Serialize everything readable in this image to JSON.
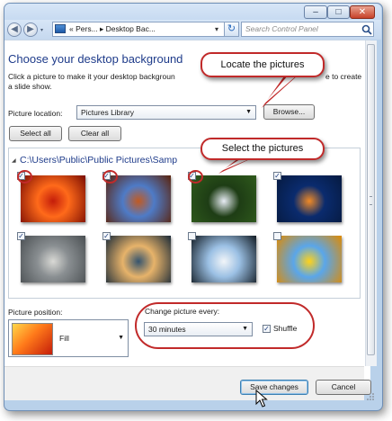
{
  "window": {
    "minimize_glyph": "–",
    "maximize_glyph": "□",
    "close_glyph": "✕"
  },
  "nav": {
    "back_glyph": "◀",
    "forward_glyph": "▶",
    "breadcrumb": "«  Pers...  ▸  Desktop Bac...",
    "dropdown_glyph": "▾",
    "refresh_glyph": "↻",
    "search_placeholder": "Search Control Panel",
    "search_icon": "search-icon"
  },
  "page": {
    "title": "Choose your desktop background",
    "desc_left": "Click a picture to make it your desktop backgroun",
    "desc_right": "e to create",
    "desc_line2": "a slide show.",
    "picture_location_label": "Picture location:",
    "picture_location_value": "Pictures Library",
    "browse_label": "Browse...",
    "select_all_label": "Select all",
    "clear_all_label": "Clear all",
    "folder_path": "C:\\Users\\Public\\Public Pictures\\Samp",
    "picture_position_label": "Picture position:",
    "picture_position_value": "Fill",
    "change_every_label": "Change picture every:",
    "change_every_value": "30 minutes",
    "shuffle_label": "Shuffle",
    "shuffle_checked": true,
    "save_label": "Save changes",
    "cancel_label": "Cancel"
  },
  "callouts": {
    "locate": "Locate the pictures",
    "select": "Select the pictures"
  },
  "thumbnails": [
    {
      "name": "Red flower",
      "checked": true,
      "colors": [
        "#ff6a1a",
        "#c41d0a",
        "#7a0c02"
      ]
    },
    {
      "name": "Desert mesa",
      "checked": true,
      "colors": [
        "#4e7bc7",
        "#c15a22",
        "#5b220a"
      ]
    },
    {
      "name": "Hydrangea",
      "checked": true,
      "colors": [
        "#1e3d15",
        "#e8edf5",
        "#2f5a1c"
      ]
    },
    {
      "name": "Jellyfish",
      "checked": true,
      "colors": [
        "#0a2b6e",
        "#f08a26",
        "#061a40"
      ]
    },
    {
      "name": "Koala",
      "checked": true,
      "colors": [
        "#8a8f92",
        "#d9d9d5",
        "#4a4f52"
      ]
    },
    {
      "name": "Lighthouse",
      "checked": true,
      "colors": [
        "#e7b36a",
        "#35546e",
        "#1a2a38"
      ]
    },
    {
      "name": "Penguins",
      "checked": false,
      "colors": [
        "#9bc0e4",
        "#f2f5f8",
        "#111a22"
      ]
    },
    {
      "name": "Tulips",
      "checked": false,
      "colors": [
        "#5aa6ea",
        "#ffd21a",
        "#e08a00"
      ]
    }
  ],
  "accent": {
    "title_blue": "#1e3b8a",
    "annotation_red": "#c12a2a"
  }
}
